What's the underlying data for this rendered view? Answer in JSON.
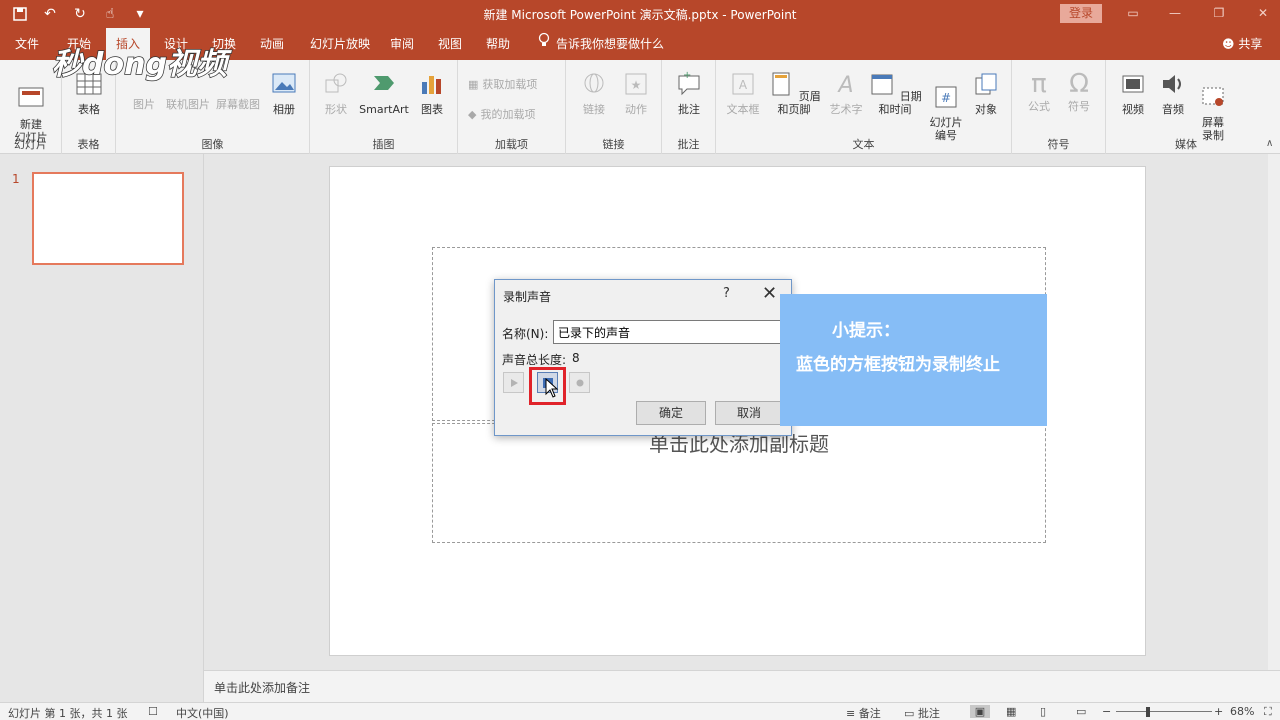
{
  "window": {
    "title": "新建 Microsoft PowerPoint 演示文稿.pptx  -  PowerPoint",
    "login_label": "登录",
    "accent_color": "#b7472a"
  },
  "tabs": {
    "file": "文件",
    "home": "开始",
    "insert": "插入",
    "design": "设计",
    "transitions": "切换",
    "animations": "动画",
    "slideshow": "幻灯片放映",
    "review": "审阅",
    "view": "视图",
    "help": "帮助",
    "tell_me": "告诉我你想要做什么",
    "share": "共享"
  },
  "watermark": {
    "text": "秒dong视频"
  },
  "ribbon": {
    "slides": {
      "label": "幻灯片",
      "new_slide": "新建\n幻灯片"
    },
    "tables": {
      "label": "表格",
      "table": "表格"
    },
    "images": {
      "label": "图像",
      "picture": "图片",
      "online_picture": "联机图片",
      "screenshot": "屏幕截图",
      "album": "相册"
    },
    "illustrations": {
      "label": "插图",
      "shapes": "形状",
      "smartart": "SmartArt",
      "chart": "图表"
    },
    "addins": {
      "label": "加载项",
      "get_addins": "获取加载项",
      "my_addins": "我的加载项"
    },
    "links": {
      "label": "链接",
      "link": "链接",
      "action": "动作"
    },
    "comments": {
      "label": "批注",
      "comment": "批注"
    },
    "text": {
      "label": "文本",
      "textbox": "文本框",
      "header_footer": "页眉和页脚",
      "wordart": "艺术字",
      "datetime": "日期和时间",
      "slide_number": "幻灯片\n编号",
      "object": "对象"
    },
    "symbols": {
      "label": "符号",
      "equation": "公式",
      "symbol": "符号"
    },
    "media": {
      "label": "媒体",
      "video": "视频",
      "audio": "音频",
      "screen_recording": "屏幕\n录制"
    }
  },
  "thumbnails": {
    "slide_number": "1"
  },
  "slide": {
    "subtitle_placeholder": "单击此处添加副标题"
  },
  "dialog": {
    "title": "录制声音",
    "help": "?",
    "name_label": "名称(N):",
    "name_value": "已录下的声音",
    "length_label": "声音总长度:",
    "length_value": "8",
    "ok": "确定",
    "cancel": "取消"
  },
  "tip": {
    "title": "小提示：",
    "body": "蓝色的方框按钮为录制终止"
  },
  "notes": {
    "placeholder": "单击此处添加备注"
  },
  "status": {
    "slide_info": "幻灯片 第 1 张，共 1 张",
    "language": "中文(中国)",
    "notes_btn": "备注",
    "comments_btn": "批注",
    "zoom": "68%"
  }
}
